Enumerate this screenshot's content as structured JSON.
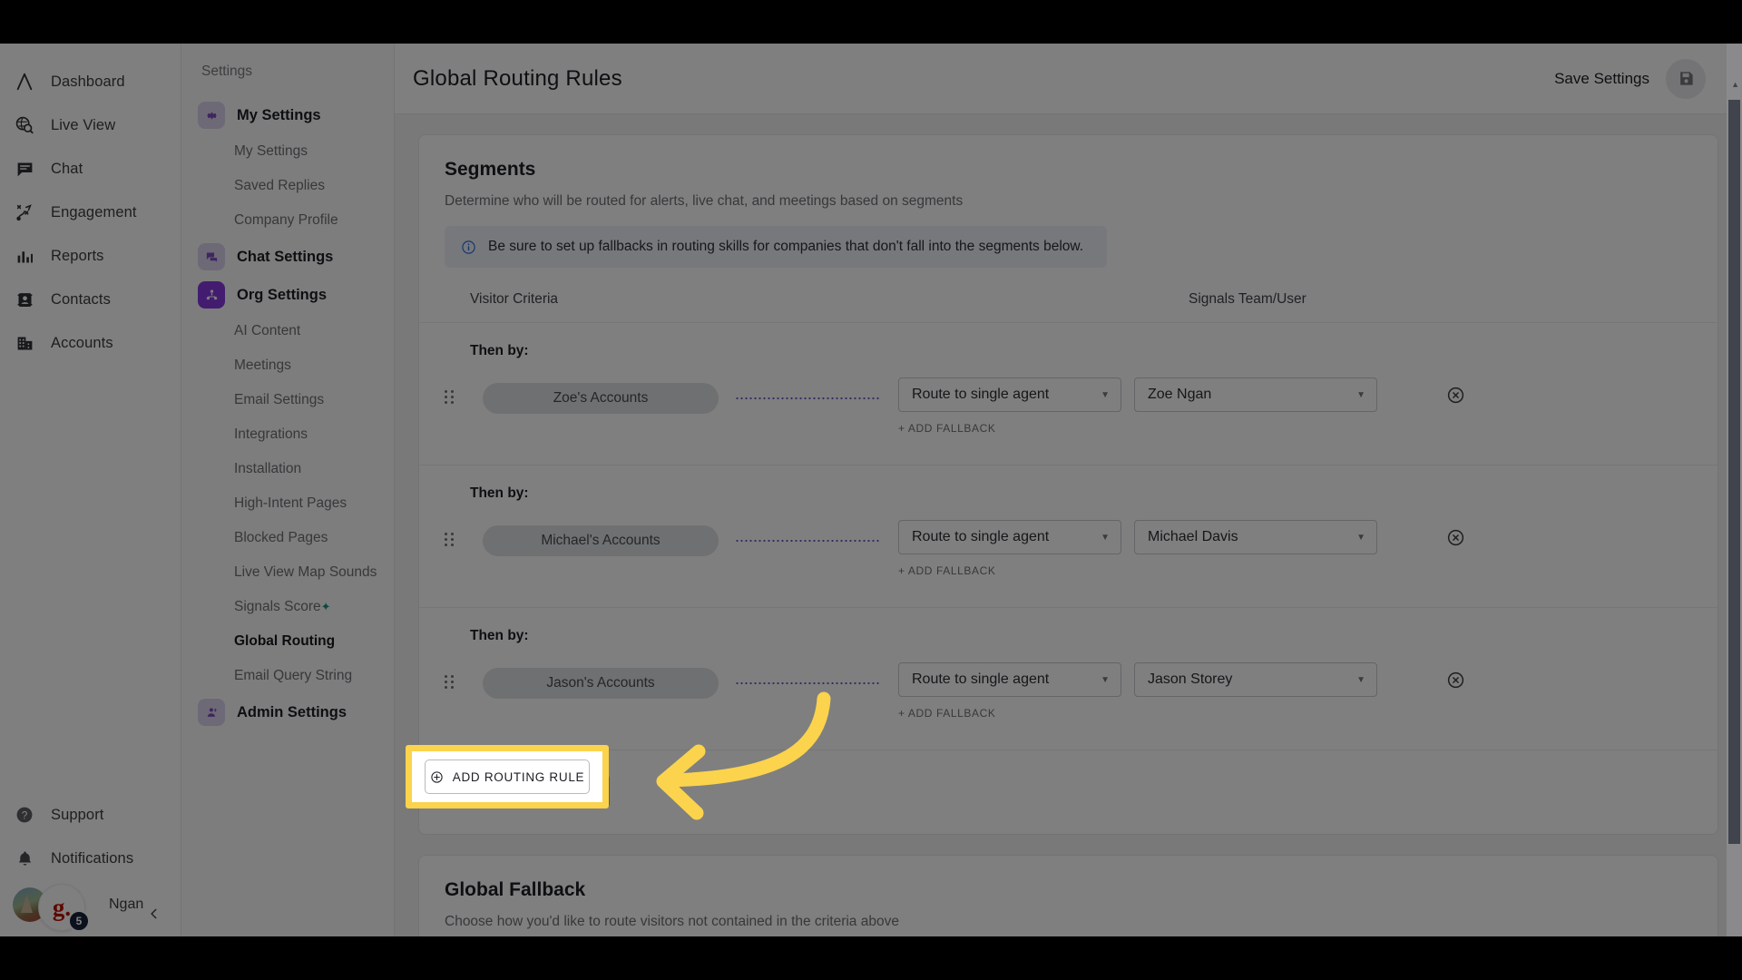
{
  "left_nav": {
    "items": [
      {
        "label": "Dashboard",
        "icon": "logo-caret-icon"
      },
      {
        "label": "Live View",
        "icon": "globe-search-icon"
      },
      {
        "label": "Chat",
        "icon": "chat-bubble-icon"
      },
      {
        "label": "Engagement",
        "icon": "engagement-path-icon"
      },
      {
        "label": "Reports",
        "icon": "bar-chart-icon"
      },
      {
        "label": "Contacts",
        "icon": "contact-card-icon"
      },
      {
        "label": "Accounts",
        "icon": "building-icon"
      }
    ],
    "bottom": [
      {
        "label": "Support",
        "icon": "question-circle-icon"
      },
      {
        "label": "Notifications",
        "icon": "bell-icon"
      }
    ],
    "user": {
      "name": "Ngan",
      "badge_letter": "g.",
      "badge_count": "5"
    }
  },
  "settings_nav": {
    "title": "Settings",
    "groups": [
      {
        "label": "My Settings",
        "icon": "gear-icon",
        "active": false,
        "children": [
          "My Settings",
          "Saved Replies",
          "Company Profile"
        ]
      },
      {
        "label": "Chat Settings",
        "icon": "chat-settings-icon",
        "active": false,
        "children": []
      },
      {
        "label": "Org Settings",
        "icon": "org-people-icon",
        "active": true,
        "children": [
          "AI Content",
          "Meetings",
          "Email Settings",
          "Integrations",
          "Installation",
          "High-Intent Pages",
          "Blocked Pages",
          "Live View Map Sounds",
          "Signals Score",
          "Global Routing",
          "Email Query String"
        ],
        "child_with_star": "Signals Score",
        "active_child": "Global Routing"
      },
      {
        "label": "Admin Settings",
        "icon": "admin-person-icon",
        "active": false,
        "children": []
      }
    ]
  },
  "header": {
    "title": "Global Routing Rules",
    "save_label": "Save Settings",
    "save_icon": "floppy-disk-icon"
  },
  "segments": {
    "heading": "Segments",
    "subheading": "Determine who will be routed for alerts, live chat, and meetings based on segments",
    "notice": "Be sure to set up fallbacks in routing skills for companies that don't fall into the segments below.",
    "notice_icon": "info-circle-icon",
    "columns": {
      "visitor": "Visitor Criteria",
      "team": "Signals Team/User"
    },
    "then_by_label": "Then by:",
    "add_fallback_label": "+ ADD FALLBACK",
    "remove_icon": "close-circle-icon",
    "drag_icon": "drag-handle-icon",
    "rows": [
      {
        "segment": "Zoe's Accounts",
        "action": "Route to single agent",
        "agent": "Zoe Ngan"
      },
      {
        "segment": "Michael's Accounts",
        "action": "Route to single agent",
        "agent": "Michael Davis"
      },
      {
        "segment": "Jason's Accounts",
        "action": "Route to single agent",
        "agent": "Jason Storey"
      }
    ],
    "add_rule_label": "ADD ROUTING RULE",
    "add_rule_icon": "plus-circle-icon"
  },
  "global_fallback": {
    "heading": "Global Fallback",
    "subheading": "Choose how you'd like to route visitors not contained in the criteria above"
  },
  "annotation": {
    "highlight_color": "#fbd34d",
    "arrow_color": "#fbd34d",
    "target": "ADD ROUTING RULE"
  }
}
